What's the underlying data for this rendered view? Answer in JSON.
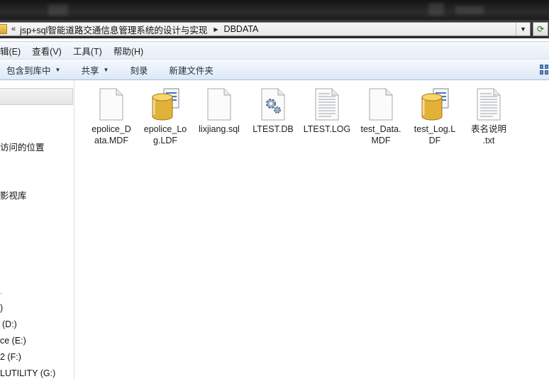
{
  "address_bar": {
    "overflow_chevron": "«",
    "crumbs": [
      "jsp+sql智能道路交通信息管理系统的设计与实现",
      "DBDATA"
    ]
  },
  "menu": [
    "编辑(E)",
    "查看(V)",
    "工具(T)",
    "帮助(H)"
  ],
  "menu_visible": [
    "辑(E)",
    "查看(V)",
    "工具(T)",
    "帮助(H)"
  ],
  "commands": {
    "include_library": "包含到库中",
    "share": "共享",
    "burn": "刻录",
    "new_folder": "新建文件夹"
  },
  "nav": {
    "recent_places": "访问的位置",
    "video_library": "影视库",
    "drive_c": ")",
    "drive_d": "(D:)",
    "drive_e": "ce (E:)",
    "drive_f": "2 (F:)",
    "drive_g": "LUTILITY (G:)"
  },
  "files": [
    {
      "name": "epolice_Data.MDF",
      "line1": "epolice_D",
      "line2": "ata.MDF",
      "icon": "blank-document-icon"
    },
    {
      "name": "epolice_Log.LDF",
      "line1": "epolice_Lo",
      "line2": "g.LDF",
      "icon": "database-icon"
    },
    {
      "name": "lixjiang.sql",
      "line1": "lixjiang.sql",
      "line2": "",
      "icon": "blank-document-icon"
    },
    {
      "name": "LTEST.DB",
      "line1": "LTEST.DB",
      "line2": "",
      "icon": "settings-document-icon"
    },
    {
      "name": "LTEST.LOG",
      "line1": "LTEST.LOG",
      "line2": "",
      "icon": "text-document-icon"
    },
    {
      "name": "test_Data.MDF",
      "line1": "test_Data.",
      "line2": "MDF",
      "icon": "blank-document-icon"
    },
    {
      "name": "test_Log.LDF",
      "line1": "test_Log.L",
      "line2": "DF",
      "icon": "database-icon"
    },
    {
      "name": "表名说明.txt",
      "line1": "表名说明",
      "line2": ".txt",
      "icon": "text-document-icon"
    }
  ],
  "colors": {
    "titlebar": "#1d1d1d",
    "commandbar": "#dde8f6",
    "folder_yellow": "#f8d46a"
  }
}
